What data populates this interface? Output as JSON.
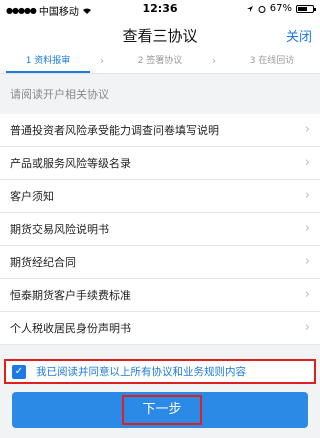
{
  "status_bar": {
    "carrier": "中国移动",
    "time": "12:36",
    "battery_percent": "67%",
    "battery_level": 0.67,
    "icons": [
      "signal-dots-icon",
      "wifi-icon",
      "location-icon",
      "alarm-icon",
      "battery-icon"
    ]
  },
  "nav": {
    "title": "查看三协议",
    "close_label": "关闭"
  },
  "steps": [
    {
      "label": "1 资料报审",
      "active": true
    },
    {
      "label": "2 签署协议",
      "active": false
    },
    {
      "label": "3 在线回访",
      "active": false
    }
  ],
  "section": {
    "header": "请阅读开户相关协议"
  },
  "agreements": [
    {
      "label": "普通投资者风险承受能力调查问卷填写说明"
    },
    {
      "label": "产品或服务风险等级名录"
    },
    {
      "label": "客户须知"
    },
    {
      "label": "期货交易风险说明书"
    },
    {
      "label": "期货经纪合同"
    },
    {
      "label": "恒泰期货客户手续费标准"
    },
    {
      "label": "个人税收居民身份声明书"
    }
  ],
  "agree": {
    "text": "我已阅读并同意以上所有协议和业务规则内容",
    "checked": true
  },
  "next_button": {
    "label": "下一步"
  },
  "colors": {
    "accent": "#1c7be0",
    "button": "#2b8ae6",
    "highlight": "#e01f1f"
  }
}
